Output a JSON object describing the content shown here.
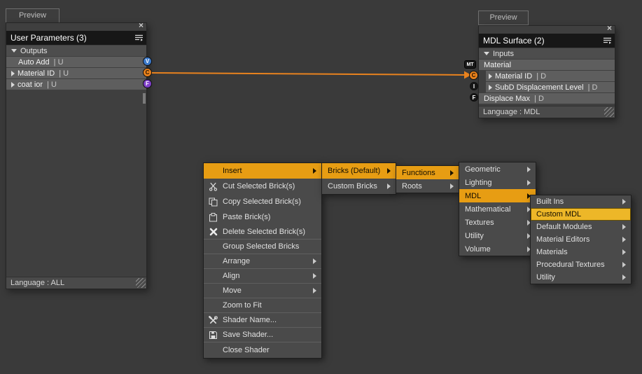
{
  "colors": {
    "background": "#3A3A3A",
    "menu_highlight": "#E79D13",
    "hover_highlight": "#EDB728",
    "connection_wire": "#E8821E",
    "connector_blue": "#3A78C9",
    "connector_orange": "#E8811C",
    "connector_purple": "#7F3FC9"
  },
  "left_node": {
    "preview_tab": "Preview",
    "title": "User Parameters (3)",
    "close_label": "×",
    "section": "Outputs",
    "rows": [
      {
        "label": "Auto Add",
        "type": "| U",
        "connector": "V"
      },
      {
        "label": "Material ID",
        "type": "| U",
        "connector": "C"
      },
      {
        "label": "coat ior",
        "type": "| U",
        "connector": "F"
      }
    ],
    "footer": "Language : ALL"
  },
  "right_node": {
    "preview_tab": "Preview",
    "title": "MDL Surface (2)",
    "close_label": "×",
    "section": "Inputs",
    "rows": [
      {
        "label": "Material",
        "type": "",
        "connector": "MT"
      },
      {
        "label": "Material ID",
        "type": "| D",
        "connector": "C"
      },
      {
        "label": "SubD Displacement Level",
        "type": "| D",
        "connector": "I"
      },
      {
        "label": "Displace Max",
        "type": "| D",
        "connector": "F"
      }
    ],
    "footer": "Language : MDL"
  },
  "context_menu": {
    "items": [
      {
        "label": "Insert",
        "highlighted": true,
        "submenu": true
      },
      {
        "label": "Cut Selected Brick(s)"
      },
      {
        "label": "Copy Selected Brick(s)"
      },
      {
        "label": "Paste Brick(s)"
      },
      {
        "label": "Delete Selected Brick(s)"
      },
      {
        "label": "Group Selected Bricks"
      },
      {
        "label": "Arrange",
        "submenu": true
      },
      {
        "label": "Align",
        "submenu": true
      },
      {
        "label": "Move",
        "submenu": true
      },
      {
        "label": "Zoom to Fit"
      },
      {
        "label": "Shader Name..."
      },
      {
        "label": "Save Shader..."
      },
      {
        "label": "Close Shader"
      }
    ]
  },
  "bricks_menu": {
    "items": [
      {
        "label": "Bricks (Default)",
        "highlighted": true,
        "submenu": true
      },
      {
        "label": "Custom Bricks",
        "submenu": true
      }
    ]
  },
  "type_menu": {
    "items": [
      {
        "label": "Functions",
        "highlighted": true,
        "submenu": true
      },
      {
        "label": "Roots",
        "submenu": true
      }
    ]
  },
  "category_menu": {
    "items": [
      {
        "label": "Geometric",
        "submenu": true
      },
      {
        "label": "Lighting",
        "submenu": true
      },
      {
        "label": "MDL",
        "highlighted": true,
        "submenu": true
      },
      {
        "label": "Mathematical",
        "submenu": true
      },
      {
        "label": "Textures",
        "submenu": true
      },
      {
        "label": "Utility",
        "submenu": true
      },
      {
        "label": "Volume",
        "submenu": true
      }
    ]
  },
  "mdl_menu": {
    "items": [
      {
        "label": "Built Ins",
        "submenu": true
      },
      {
        "label": "Custom MDL",
        "highlighted": true
      },
      {
        "label": "Default Modules",
        "submenu": true
      },
      {
        "label": "Material Editors",
        "submenu": true
      },
      {
        "label": "Materials",
        "submenu": true
      },
      {
        "label": "Procedural Textures",
        "submenu": true
      },
      {
        "label": "Utility",
        "submenu": true
      }
    ]
  }
}
